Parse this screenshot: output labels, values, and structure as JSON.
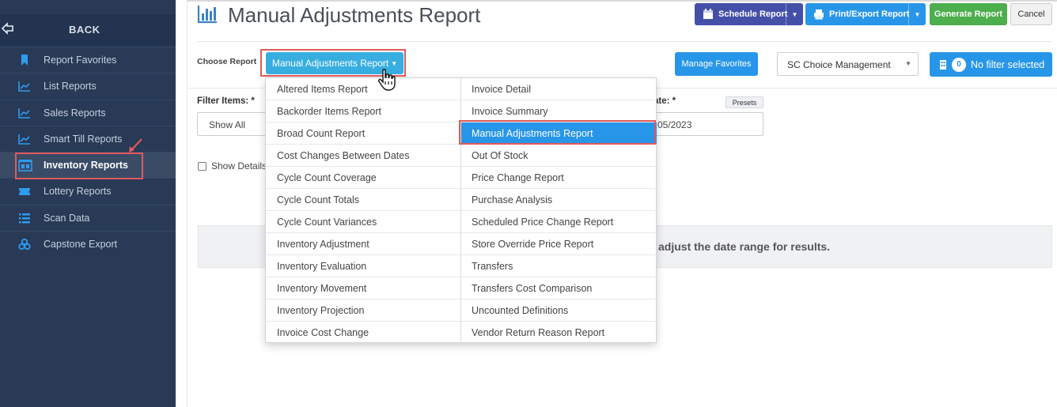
{
  "sidebar": {
    "back_label": "BACK",
    "items": [
      {
        "label": "Report Favorites",
        "icon": "bookmark-icon"
      },
      {
        "label": "List Reports",
        "icon": "line-chart-icon"
      },
      {
        "label": "Sales Reports",
        "icon": "line-chart-icon"
      },
      {
        "label": "Smart Till Reports",
        "icon": "line-chart-icon"
      },
      {
        "label": "Inventory Reports",
        "icon": "inventory-icon",
        "active": true
      },
      {
        "label": "Lottery Reports",
        "icon": "ticket-icon"
      },
      {
        "label": "Scan Data",
        "icon": "list-icon"
      },
      {
        "label": "Capstone Export",
        "icon": "cubes-icon"
      }
    ]
  },
  "header": {
    "title": "Manual Adjustments Report",
    "schedule_label": "Schedule Report",
    "print_label": "Print/Export Report",
    "generate_label": "Generate Report",
    "cancel_label": "Cancel"
  },
  "choose": {
    "label": "Choose Report",
    "selected": "Manual Adjustments Report"
  },
  "favorites_label": "Manage Favorites",
  "store_select": "SC Choice Management",
  "filter_button": {
    "count": "0",
    "label": "No filter selected"
  },
  "filters": {
    "items_label": "Filter Items: *",
    "items_value": "Show All",
    "date_label": "ate: *",
    "presets_label": "Presets",
    "date_value": "05/2023",
    "show_details_label": "Show Details"
  },
  "message": "adjust the date range for results.",
  "menu": {
    "left": [
      "Altered Items Report",
      "Backorder Items Report",
      "Broad Count Report",
      "Cost Changes Between Dates",
      "Cycle Count Coverage",
      "Cycle Count Totals",
      "Cycle Count Variances",
      "Inventory Adjustment",
      "Inventory Evaluation",
      "Inventory Movement",
      "Inventory Projection",
      "Invoice Cost Change"
    ],
    "right": [
      "Invoice Detail",
      "Invoice Summary",
      "Manual Adjustments Report",
      "Out Of Stock",
      "Price Change Report",
      "Purchase Analysis",
      "Scheduled Price Change Report",
      "Store Override Price Report",
      "Transfers",
      "Transfers Cost Comparison",
      "Uncounted Definitions",
      "Vendor Return Reason Report"
    ]
  },
  "colors": {
    "sidebar": "#283a55",
    "accent": "#2896e8",
    "highlight": "#e05a5a"
  }
}
